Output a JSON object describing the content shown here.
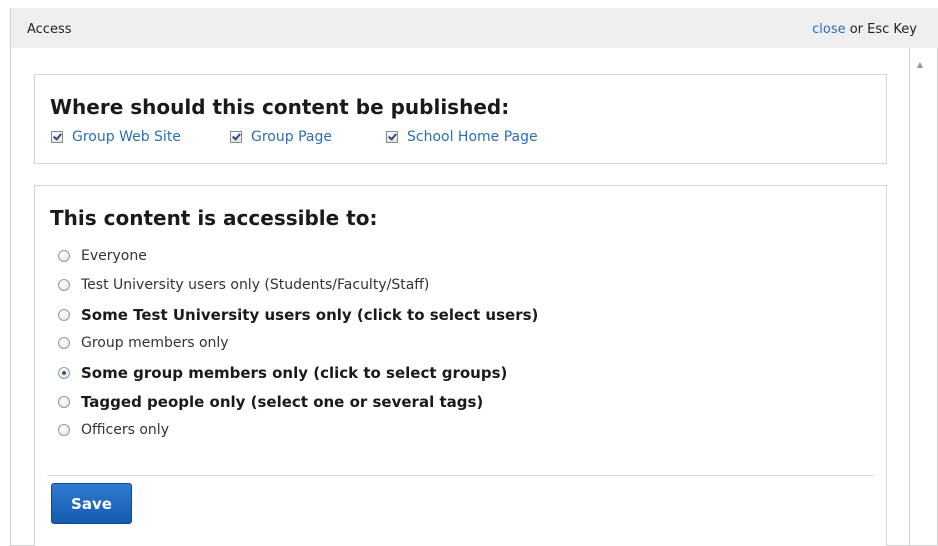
{
  "dialog": {
    "title": "Access",
    "close_link": "close",
    "close_rest": " or Esc Key"
  },
  "publish": {
    "heading": "Where should this content be published:",
    "options": [
      {
        "label": "Group Web Site",
        "checked": true
      },
      {
        "label": "Group Page",
        "checked": true
      },
      {
        "label": "School Home Page",
        "checked": true
      }
    ]
  },
  "access": {
    "heading": "This content is accessible to:",
    "options": [
      {
        "label": "Everyone",
        "bold": false,
        "selected": false
      },
      {
        "label": "Test University users only (Students/Faculty/Staff)",
        "bold": false,
        "selected": false
      },
      {
        "label": "Some Test University users only (click to select users)",
        "bold": true,
        "selected": false
      },
      {
        "label": "Group members only",
        "bold": false,
        "selected": false
      },
      {
        "label": "Some group members only (click to select groups)",
        "bold": true,
        "selected": true
      },
      {
        "label": "Tagged people only (select one or several tags)",
        "bold": true,
        "selected": false
      },
      {
        "label": "Officers only",
        "bold": false,
        "selected": false
      }
    ]
  },
  "actions": {
    "save_label": "Save"
  }
}
